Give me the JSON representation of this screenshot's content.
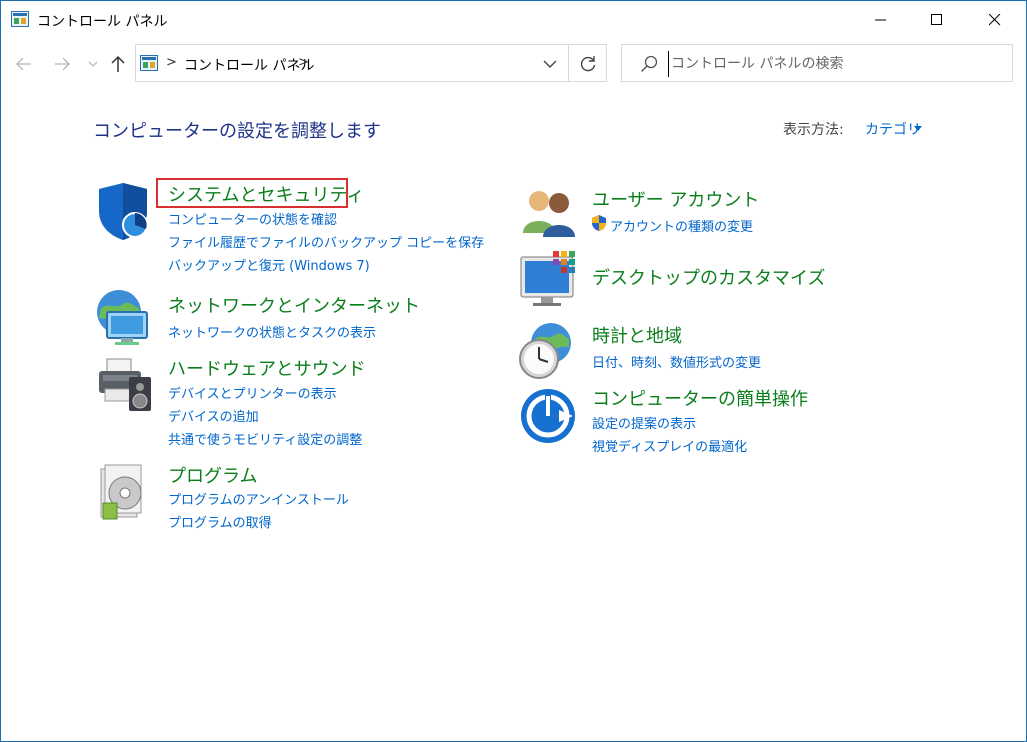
{
  "window": {
    "title": "コントロール パネル"
  },
  "address_bar": {
    "crumb": "コントロール パネル",
    "separator": ">"
  },
  "search": {
    "placeholder": "コントロール パネルの検索"
  },
  "main": {
    "heading": "コンピューターの設定を調整します",
    "view_by_label": "表示方法:",
    "view_by_value": "カテゴリ"
  },
  "categories_left": [
    {
      "title": "システムとセキュリティ",
      "icon": "shield-icon",
      "links": [
        "コンピューターの状態を確認",
        "ファイル履歴でファイルのバックアップ コピーを保存",
        "バックアップと復元 (Windows 7)"
      ]
    },
    {
      "title": "ネットワークとインターネット",
      "icon": "network-globe-icon",
      "links": [
        "ネットワークの状態とタスクの表示"
      ]
    },
    {
      "title": "ハードウェアとサウンド",
      "icon": "printer-speaker-icon",
      "links": [
        "デバイスとプリンターの表示",
        "デバイスの追加",
        "共通で使うモビリティ設定の調整"
      ]
    },
    {
      "title": "プログラム",
      "icon": "programs-disc-icon",
      "links": [
        "プログラムのアンインストール",
        "プログラムの取得"
      ]
    }
  ],
  "categories_right": [
    {
      "title": "ユーザー アカウント",
      "icon": "users-icon",
      "links": [
        "アカウントの種類の変更"
      ]
    },
    {
      "title": "デスクトップのカスタマイズ",
      "icon": "desktop-monitor-icon",
      "links": []
    },
    {
      "title": "時計と地域",
      "icon": "clock-globe-icon",
      "links": [
        "日付、時刻、数値形式の変更"
      ]
    },
    {
      "title": "コンピューターの簡単操作",
      "icon": "ease-of-access-icon",
      "links": [
        "設定の提案の表示",
        "視覚ディスプレイの最適化"
      ]
    }
  ],
  "colors": {
    "category_title": "#0b7e1c",
    "link": "#0066cc",
    "heading": "#1e3287",
    "highlight": "#d83030",
    "window_border": "#1b6fb0"
  }
}
